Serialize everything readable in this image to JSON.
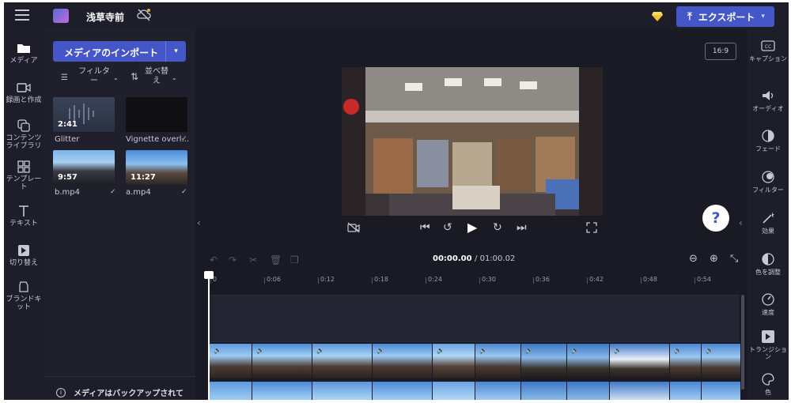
{
  "app": {
    "project_title": "浅草寺前",
    "export_label": "エクスポート",
    "menu_icon": "hamburger-icon",
    "cloud_icon": "cloud-off-icon",
    "premium_icon": "diamond-icon",
    "accent": "#4556c7"
  },
  "left_nav": [
    {
      "label": "メディア",
      "icon": "folder-icon"
    },
    {
      "label": "録画と作成",
      "icon": "camera-icon"
    },
    {
      "label": "コンテンツライブラリ",
      "icon": "library-icon"
    },
    {
      "label": "テンプレート",
      "icon": "template-icon"
    },
    {
      "label": "テキスト",
      "icon": "text-icon"
    },
    {
      "label": "切り替え",
      "icon": "transition-icon"
    },
    {
      "label": "ブランドキット",
      "icon": "brand-kit-icon"
    }
  ],
  "media": {
    "import_label": "メディアのインポート",
    "filter_label": "フィルター",
    "sort_label": "並べ替え",
    "items": [
      {
        "name": "Glitter",
        "duration": "2:41"
      },
      {
        "name": "Vignette overl...",
        "duration": ""
      },
      {
        "name": "b.mp4",
        "duration": "9:57"
      },
      {
        "name": "a.mp4",
        "duration": "11:27"
      }
    ],
    "backup_text": "メディアはバックアップされて"
  },
  "preview": {
    "aspect_ratio": "16:9",
    "help_label": "?"
  },
  "right_nav": [
    {
      "label": "キャプション",
      "icon": "captions-icon"
    },
    {
      "label": "オーディオ",
      "icon": "audio-icon"
    },
    {
      "label": "フェード",
      "icon": "fade-icon"
    },
    {
      "label": "フィルター",
      "icon": "filter-icon"
    },
    {
      "label": "効果",
      "icon": "effects-icon"
    },
    {
      "label": "色を調整",
      "icon": "adjust-color-icon"
    },
    {
      "label": "速度",
      "icon": "speed-icon"
    },
    {
      "label": "トランジション",
      "icon": "transition-icon"
    },
    {
      "label": "色",
      "icon": "palette-icon"
    }
  ],
  "timeline": {
    "current_time": "00:00.00",
    "total_time": "/ 01:00.02",
    "ticks": [
      "0",
      "0:06",
      "0:12",
      "0:18",
      "0:24",
      "0:30",
      "0:36",
      "0:42",
      "0:48",
      "0:54"
    ]
  }
}
